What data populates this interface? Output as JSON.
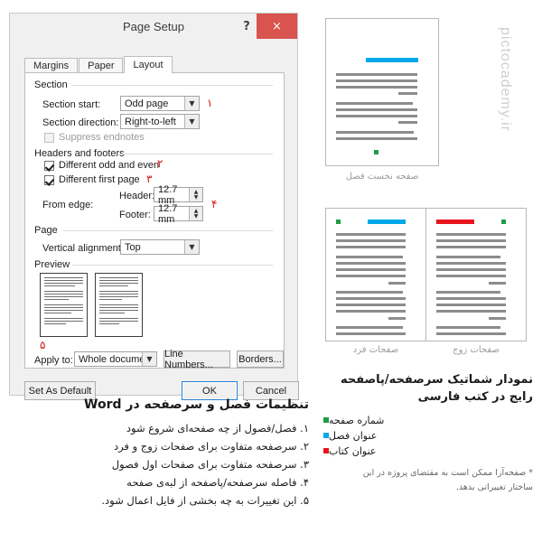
{
  "dialog": {
    "title": "Page Setup",
    "help_label": "?",
    "close_label": "×",
    "tabs": [
      {
        "label": "Margins",
        "active": false
      },
      {
        "label": "Paper",
        "active": false
      },
      {
        "label": "Layout",
        "active": true
      }
    ],
    "groups": {
      "section": {
        "label": "Section",
        "section_start_label": "Section start:",
        "section_start_value": "Odd page",
        "section_direction_label": "Section direction:",
        "section_direction_value": "Right-to-left",
        "suppress_endnotes_label": "Suppress endnotes",
        "suppress_endnotes_checked": false
      },
      "headers_footers": {
        "label": "Headers and footers",
        "different_odd_even_label": "Different odd and even",
        "different_odd_even_checked": true,
        "different_first_page_label": "Different first page",
        "different_first_page_checked": true,
        "from_edge_label": "From edge:",
        "header_label": "Header:",
        "header_value": "12.7 mm",
        "footer_label": "Footer:",
        "footer_value": "12.7 mm"
      },
      "page": {
        "label": "Page",
        "vertical_alignment_label": "Vertical alignment:",
        "vertical_alignment_value": "Top"
      },
      "preview": {
        "label": "Preview"
      }
    },
    "apply_to_label": "Apply to:",
    "apply_to_value": "Whole document",
    "line_numbers_button": "Line Numbers...",
    "borders_button": "Borders...",
    "set_as_default_button": "Set As Default",
    "ok_button": "OK",
    "cancel_button": "Cancel",
    "callouts": [
      "۱",
      "۲",
      "۳",
      "۴",
      "۵"
    ],
    "callout_color": "#d31717"
  },
  "diagram": {
    "first_page_caption": "صفحه نخست فصل",
    "odd_pages_caption": "صفحات فرد",
    "even_pages_caption": "صفحات زوج",
    "colors": {
      "page_number": "#1f9d45",
      "chapter_title": "#00a8e8",
      "book_title": "#e8141b",
      "text_line": "#8c8c8c"
    },
    "watermark": "pictocademy.ir"
  },
  "word_block": {
    "heading": "تنظیمات فصل و سرصفحه در Word",
    "items": [
      "۱. فصل/فصول از چه صفحه‌ای شروع شود",
      "۲. سرصفحه متفاوت برای صفحات زوج و فرد",
      "۳. سرصفحه متفاوت برای صفحات اول فصول",
      "۴. فاصله سرصفحه/پاصفحه از لبه‌ی صفحه",
      "۵. این تغییرات به چه بخشی از فایل اعمال شود."
    ]
  },
  "diagram_block": {
    "heading_line1": "نمودار شماتیک سرصفحه/پاصفحه",
    "heading_line2": "رایج در کتب فارسی",
    "legend": [
      {
        "label": "شماره صفحه",
        "color": "#1f9d45"
      },
      {
        "label": "عنوان فصل",
        "color": "#00a8e8"
      },
      {
        "label": "عنوان کتاب",
        "color": "#e8141b"
      }
    ],
    "footnote_line1": "* صفحه‌آرا ممکن است به مقتضای پروژه در این",
    "footnote_line2": "ساختار تغییراتی بدهد."
  }
}
